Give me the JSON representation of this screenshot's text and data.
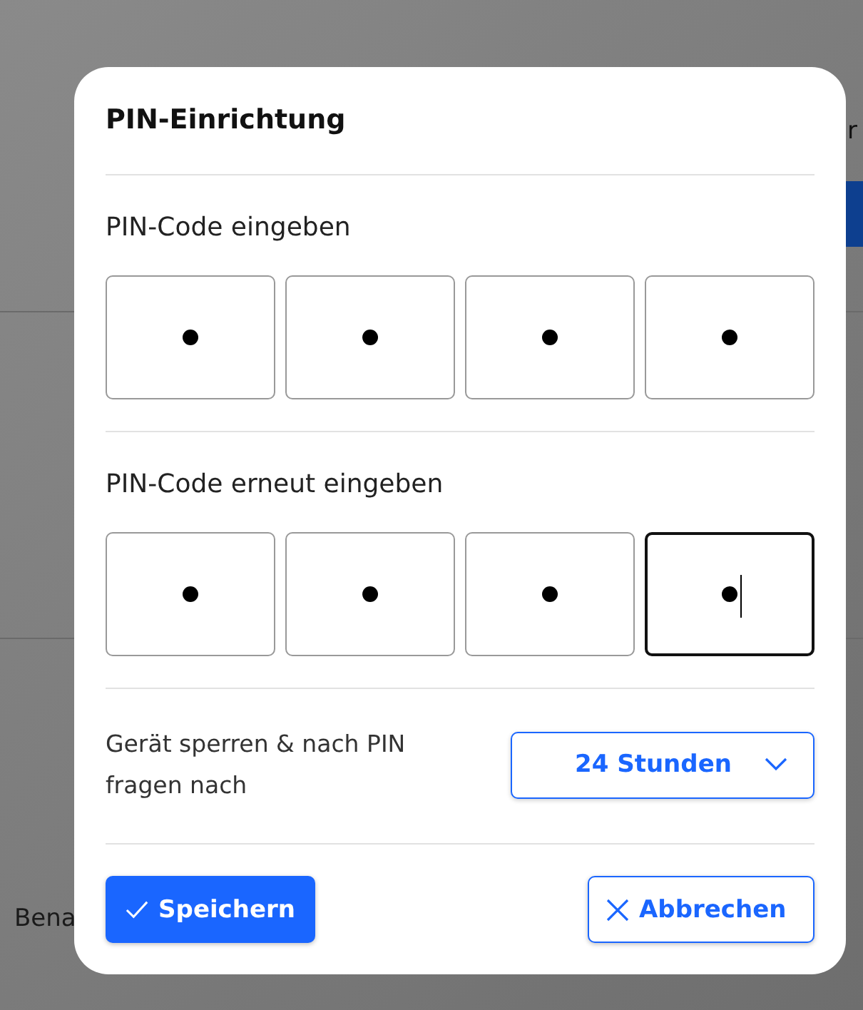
{
  "background": {
    "subtitle": "r",
    "label": "Bena"
  },
  "dialog": {
    "title": "PIN-Einrichtung",
    "sections": [
      {
        "label": "PIN-Code eingeben",
        "digits": [
          {
            "filled": true,
            "focused": false
          },
          {
            "filled": true,
            "focused": false
          },
          {
            "filled": true,
            "focused": false
          },
          {
            "filled": true,
            "focused": false
          }
        ]
      },
      {
        "label": "PIN-Code erneut eingeben",
        "digits": [
          {
            "filled": true,
            "focused": false
          },
          {
            "filled": true,
            "focused": false
          },
          {
            "filled": true,
            "focused": false
          },
          {
            "filled": true,
            "focused": true
          }
        ]
      }
    ],
    "lock": {
      "label": "Gerät sperren & nach PIN fragen nach",
      "value": "24 Stunden"
    },
    "buttons": [
      {
        "kind": "primary",
        "label": "Speichern"
      },
      {
        "kind": "secondary",
        "label": "Abbrechen"
      }
    ]
  }
}
